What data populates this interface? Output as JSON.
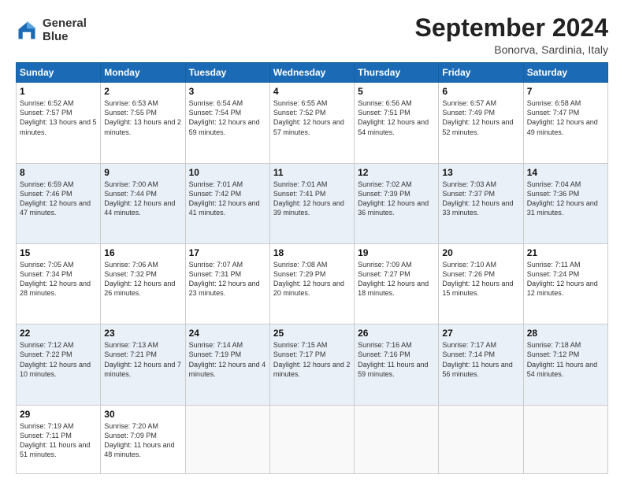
{
  "header": {
    "logo_line1": "General",
    "logo_line2": "Blue",
    "month_title": "September 2024",
    "subtitle": "Bonorva, Sardinia, Italy"
  },
  "days_of_week": [
    "Sunday",
    "Monday",
    "Tuesday",
    "Wednesday",
    "Thursday",
    "Friday",
    "Saturday"
  ],
  "weeks": [
    [
      {
        "day": "1",
        "sunrise": "6:52 AM",
        "sunset": "7:57 PM",
        "daylight": "13 hours and 5 minutes."
      },
      {
        "day": "2",
        "sunrise": "6:53 AM",
        "sunset": "7:55 PM",
        "daylight": "13 hours and 2 minutes."
      },
      {
        "day": "3",
        "sunrise": "6:54 AM",
        "sunset": "7:54 PM",
        "daylight": "12 hours and 59 minutes."
      },
      {
        "day": "4",
        "sunrise": "6:55 AM",
        "sunset": "7:52 PM",
        "daylight": "12 hours and 57 minutes."
      },
      {
        "day": "5",
        "sunrise": "6:56 AM",
        "sunset": "7:51 PM",
        "daylight": "12 hours and 54 minutes."
      },
      {
        "day": "6",
        "sunrise": "6:57 AM",
        "sunset": "7:49 PM",
        "daylight": "12 hours and 52 minutes."
      },
      {
        "day": "7",
        "sunrise": "6:58 AM",
        "sunset": "7:47 PM",
        "daylight": "12 hours and 49 minutes."
      }
    ],
    [
      {
        "day": "8",
        "sunrise": "6:59 AM",
        "sunset": "7:46 PM",
        "daylight": "12 hours and 47 minutes."
      },
      {
        "day": "9",
        "sunrise": "7:00 AM",
        "sunset": "7:44 PM",
        "daylight": "12 hours and 44 minutes."
      },
      {
        "day": "10",
        "sunrise": "7:01 AM",
        "sunset": "7:42 PM",
        "daylight": "12 hours and 41 minutes."
      },
      {
        "day": "11",
        "sunrise": "7:01 AM",
        "sunset": "7:41 PM",
        "daylight": "12 hours and 39 minutes."
      },
      {
        "day": "12",
        "sunrise": "7:02 AM",
        "sunset": "7:39 PM",
        "daylight": "12 hours and 36 minutes."
      },
      {
        "day": "13",
        "sunrise": "7:03 AM",
        "sunset": "7:37 PM",
        "daylight": "12 hours and 33 minutes."
      },
      {
        "day": "14",
        "sunrise": "7:04 AM",
        "sunset": "7:36 PM",
        "daylight": "12 hours and 31 minutes."
      }
    ],
    [
      {
        "day": "15",
        "sunrise": "7:05 AM",
        "sunset": "7:34 PM",
        "daylight": "12 hours and 28 minutes."
      },
      {
        "day": "16",
        "sunrise": "7:06 AM",
        "sunset": "7:32 PM",
        "daylight": "12 hours and 26 minutes."
      },
      {
        "day": "17",
        "sunrise": "7:07 AM",
        "sunset": "7:31 PM",
        "daylight": "12 hours and 23 minutes."
      },
      {
        "day": "18",
        "sunrise": "7:08 AM",
        "sunset": "7:29 PM",
        "daylight": "12 hours and 20 minutes."
      },
      {
        "day": "19",
        "sunrise": "7:09 AM",
        "sunset": "7:27 PM",
        "daylight": "12 hours and 18 minutes."
      },
      {
        "day": "20",
        "sunrise": "7:10 AM",
        "sunset": "7:26 PM",
        "daylight": "12 hours and 15 minutes."
      },
      {
        "day": "21",
        "sunrise": "7:11 AM",
        "sunset": "7:24 PM",
        "daylight": "12 hours and 12 minutes."
      }
    ],
    [
      {
        "day": "22",
        "sunrise": "7:12 AM",
        "sunset": "7:22 PM",
        "daylight": "12 hours and 10 minutes."
      },
      {
        "day": "23",
        "sunrise": "7:13 AM",
        "sunset": "7:21 PM",
        "daylight": "12 hours and 7 minutes."
      },
      {
        "day": "24",
        "sunrise": "7:14 AM",
        "sunset": "7:19 PM",
        "daylight": "12 hours and 4 minutes."
      },
      {
        "day": "25",
        "sunrise": "7:15 AM",
        "sunset": "7:17 PM",
        "daylight": "12 hours and 2 minutes."
      },
      {
        "day": "26",
        "sunrise": "7:16 AM",
        "sunset": "7:16 PM",
        "daylight": "11 hours and 59 minutes."
      },
      {
        "day": "27",
        "sunrise": "7:17 AM",
        "sunset": "7:14 PM",
        "daylight": "11 hours and 56 minutes."
      },
      {
        "day": "28",
        "sunrise": "7:18 AM",
        "sunset": "7:12 PM",
        "daylight": "11 hours and 54 minutes."
      }
    ],
    [
      {
        "day": "29",
        "sunrise": "7:19 AM",
        "sunset": "7:11 PM",
        "daylight": "11 hours and 51 minutes."
      },
      {
        "day": "30",
        "sunrise": "7:20 AM",
        "sunset": "7:09 PM",
        "daylight": "11 hours and 48 minutes."
      },
      null,
      null,
      null,
      null,
      null
    ]
  ]
}
